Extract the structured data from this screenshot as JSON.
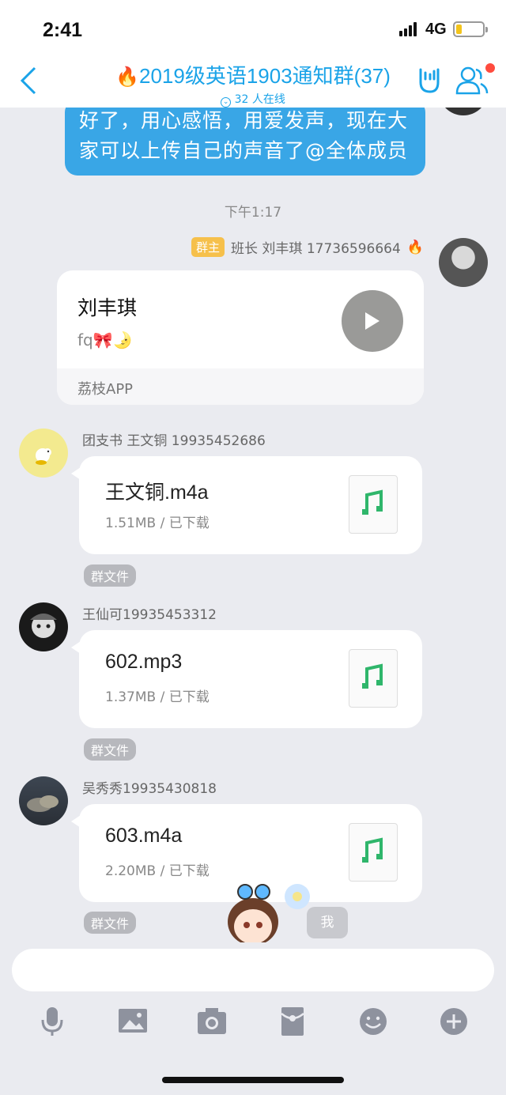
{
  "status": {
    "time": "2:41",
    "network": "4G"
  },
  "nav": {
    "title_emoji": "🔥",
    "title": "2019级英语1903通知群(37)",
    "online": "32 人在线"
  },
  "messages": {
    "top_bubble": "好了，用心感悟，用爱发声，现在大家可以上传自己的声音了@全体成员",
    "timestamp": "下午1:17",
    "owner_badge": "群主",
    "owner_sender": "班长 刘丰琪 17736596664",
    "owner_sender_emoji": "🔥",
    "music_card": {
      "title": "刘丰琪",
      "subtitle": "fq🎀🌛",
      "source": "荔枝APP"
    },
    "files": [
      {
        "sender": "团支书 王文铜 19935452686",
        "name": "王文铜.m4a",
        "meta": "1.51MB / 已下载",
        "tag": "群文件"
      },
      {
        "sender": "王仙可19935453312",
        "name": "602.mp3",
        "meta": "1.37MB / 已下载",
        "tag": "群文件"
      },
      {
        "sender": "吴秀秀19935430818",
        "name": "603.m4a",
        "meta": "2.20MB / 已下载",
        "tag": "群文件"
      }
    ],
    "me_label": "我"
  },
  "colors": {
    "accent": "#1aa3e8",
    "bubble": "#39a6e6",
    "music_green": "#2fb66b",
    "badge": "#f6c04b"
  },
  "toolbar": {
    "icons": [
      "microphone-icon",
      "image-icon",
      "camera-icon",
      "red-packet-icon",
      "emoji-icon",
      "plus-icon"
    ]
  }
}
